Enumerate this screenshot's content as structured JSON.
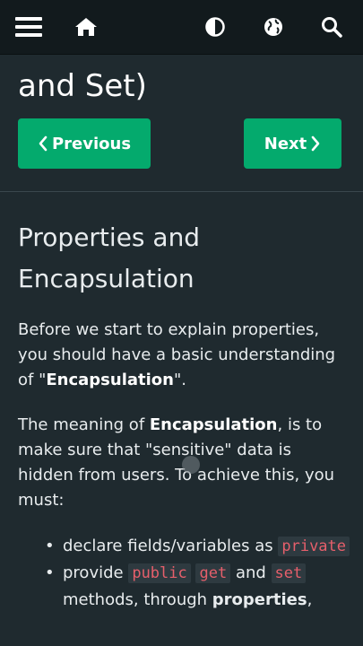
{
  "topbar": {
    "icons": [
      "menu-icon",
      "home-icon",
      "contrast-icon",
      "globe-icon",
      "search-icon"
    ]
  },
  "page": {
    "title_partial": "and Set)",
    "prev_label": "Previous",
    "next_label": "Next",
    "section_title": "Properties and Encapsulation",
    "p1": {
      "text_a": "Before we start to explain properties, you should have a basic understanding of \"",
      "bold": "Encapsulation",
      "text_b": "\"."
    },
    "p2": {
      "text_a": "The meaning of ",
      "bold": "Encapsulation",
      "text_b": ", is to make sure that \"sensitive\" data is hidden from users. To achieve this, you must:"
    },
    "list": [
      {
        "text": "declare fields/variables as ",
        "code": "private"
      },
      {
        "text": "provide ",
        "code1": "public",
        "code2": "get",
        "and": "and",
        "code3": "set",
        "text2": "methods, through ",
        "bold": "properties",
        "text3": ","
      }
    ]
  },
  "colors": {
    "background": "#1f2a2f",
    "topbar": "#121a1d",
    "accent_green": "#04aa6d",
    "code_text": "#e65f6b"
  }
}
